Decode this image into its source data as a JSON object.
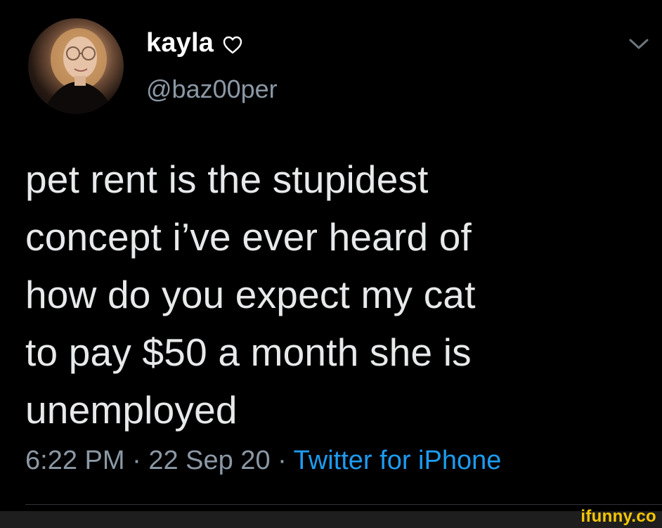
{
  "tweet": {
    "display_name": "kayla",
    "handle": "@baz00per",
    "text_lines": [
      "pet rent is the stupidest",
      "concept i’ve ever heard of",
      "how do you expect my cat",
      "to pay $50 a month she is",
      "unemployed"
    ],
    "time": "6:22 PM",
    "separator": " · ",
    "date": "22 Sep 20",
    "source": "Twitter for iPhone"
  },
  "icons": {
    "avatar": "profile-photo",
    "heart": "heart-outline-icon",
    "menu": "chevron-down-icon"
  },
  "colors": {
    "background": "#000000",
    "primary_text": "#e7e9ea",
    "secondary_text": "#8b98a5",
    "link": "#1d9bf0",
    "watermark": "#f6c700"
  },
  "watermark": {
    "text": "ifunny.co"
  }
}
